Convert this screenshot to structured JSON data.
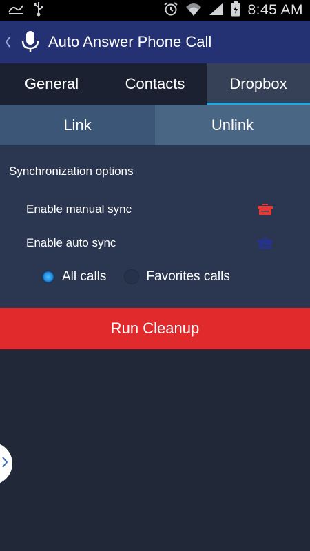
{
  "status_bar": {
    "time": "8:45 AM",
    "left_icons": [
      "tiptap-icon",
      "usb-icon"
    ],
    "right_icons": [
      "alarm-icon",
      "wifi-icon",
      "signal-icon",
      "battery-icon"
    ]
  },
  "app_bar": {
    "title": "Auto Answer Phone Call",
    "color": "#243173"
  },
  "tabs": [
    {
      "label": "General",
      "active": false
    },
    {
      "label": "Contacts",
      "active": false
    },
    {
      "label": "Dropbox",
      "active": true
    }
  ],
  "link_buttons": {
    "link": "Link",
    "unlink": "Unlink"
  },
  "sync": {
    "section_title": "Synchronization options",
    "manual_sync_label": "Enable manual sync",
    "auto_sync_label": "Enable auto sync",
    "manual_sync_icon_color": "#e53935",
    "auto_sync_icon_color": "#27338a"
  },
  "call_filter": {
    "options": [
      {
        "label": "All calls",
        "selected": true
      },
      {
        "label": "Favorites calls",
        "selected": false
      }
    ]
  },
  "actions": {
    "run_cleanup": "Run Cleanup",
    "run_cleanup_color": "#e12a2b"
  },
  "accent_color": "#21a9e1"
}
